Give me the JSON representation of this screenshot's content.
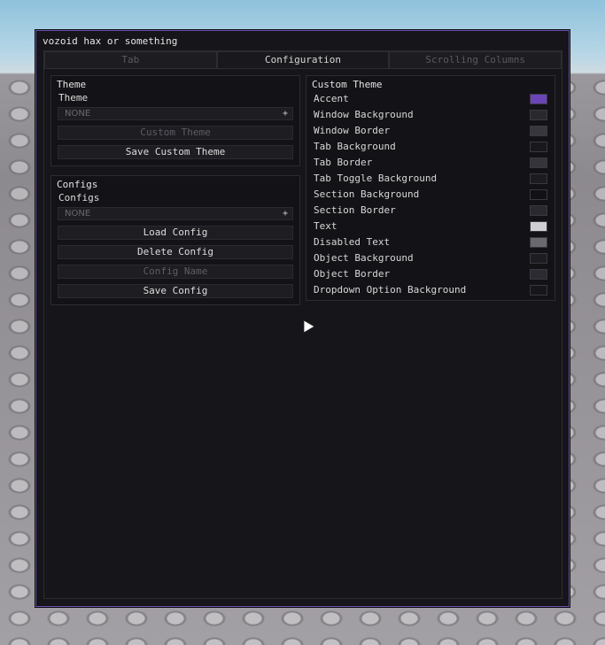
{
  "window": {
    "title": "vozoid hax or something",
    "accent": "#6c4fb0"
  },
  "tabs": [
    {
      "label": "Tab",
      "active": false
    },
    {
      "label": "Configuration",
      "active": true
    },
    {
      "label": "Scrolling Columns",
      "active": false
    }
  ],
  "theme_section": {
    "title": "Theme",
    "dropdown_label": "Theme",
    "dropdown_value": "NONE",
    "dropdown_icon": "+",
    "custom_theme_button": "Custom Theme",
    "save_custom_theme_button": "Save Custom Theme"
  },
  "configs_section": {
    "title": "Configs",
    "dropdown_label": "Configs",
    "dropdown_value": "NONE",
    "dropdown_icon": "+",
    "load_button": "Load Config",
    "delete_button": "Delete Config",
    "name_placeholder": "Config Name",
    "save_button": "Save Config"
  },
  "custom_theme": {
    "title": "Custom Theme",
    "items": [
      {
        "label": "Accent",
        "color": "#6b45b8"
      },
      {
        "label": "Window Background",
        "color": "#2a292e"
      },
      {
        "label": "Window Border",
        "color": "#38373d"
      },
      {
        "label": "Tab Background",
        "color": "#19181c"
      },
      {
        "label": "Tab Border",
        "color": "#35343a"
      },
      {
        "label": "Tab Toggle Background",
        "color": "#1d1c21"
      },
      {
        "label": "Section Background",
        "color": "#121115"
      },
      {
        "label": "Section Border",
        "color": "#2a292f"
      },
      {
        "label": "Text",
        "color": "#cfcfd3"
      },
      {
        "label": "Disabled Text",
        "color": "#6a696f"
      },
      {
        "label": "Object Background",
        "color": "#1e1d22"
      },
      {
        "label": "Object Border",
        "color": "#2c2b31"
      },
      {
        "label": "Dropdown Option Background",
        "color": "#17161a"
      }
    ]
  }
}
